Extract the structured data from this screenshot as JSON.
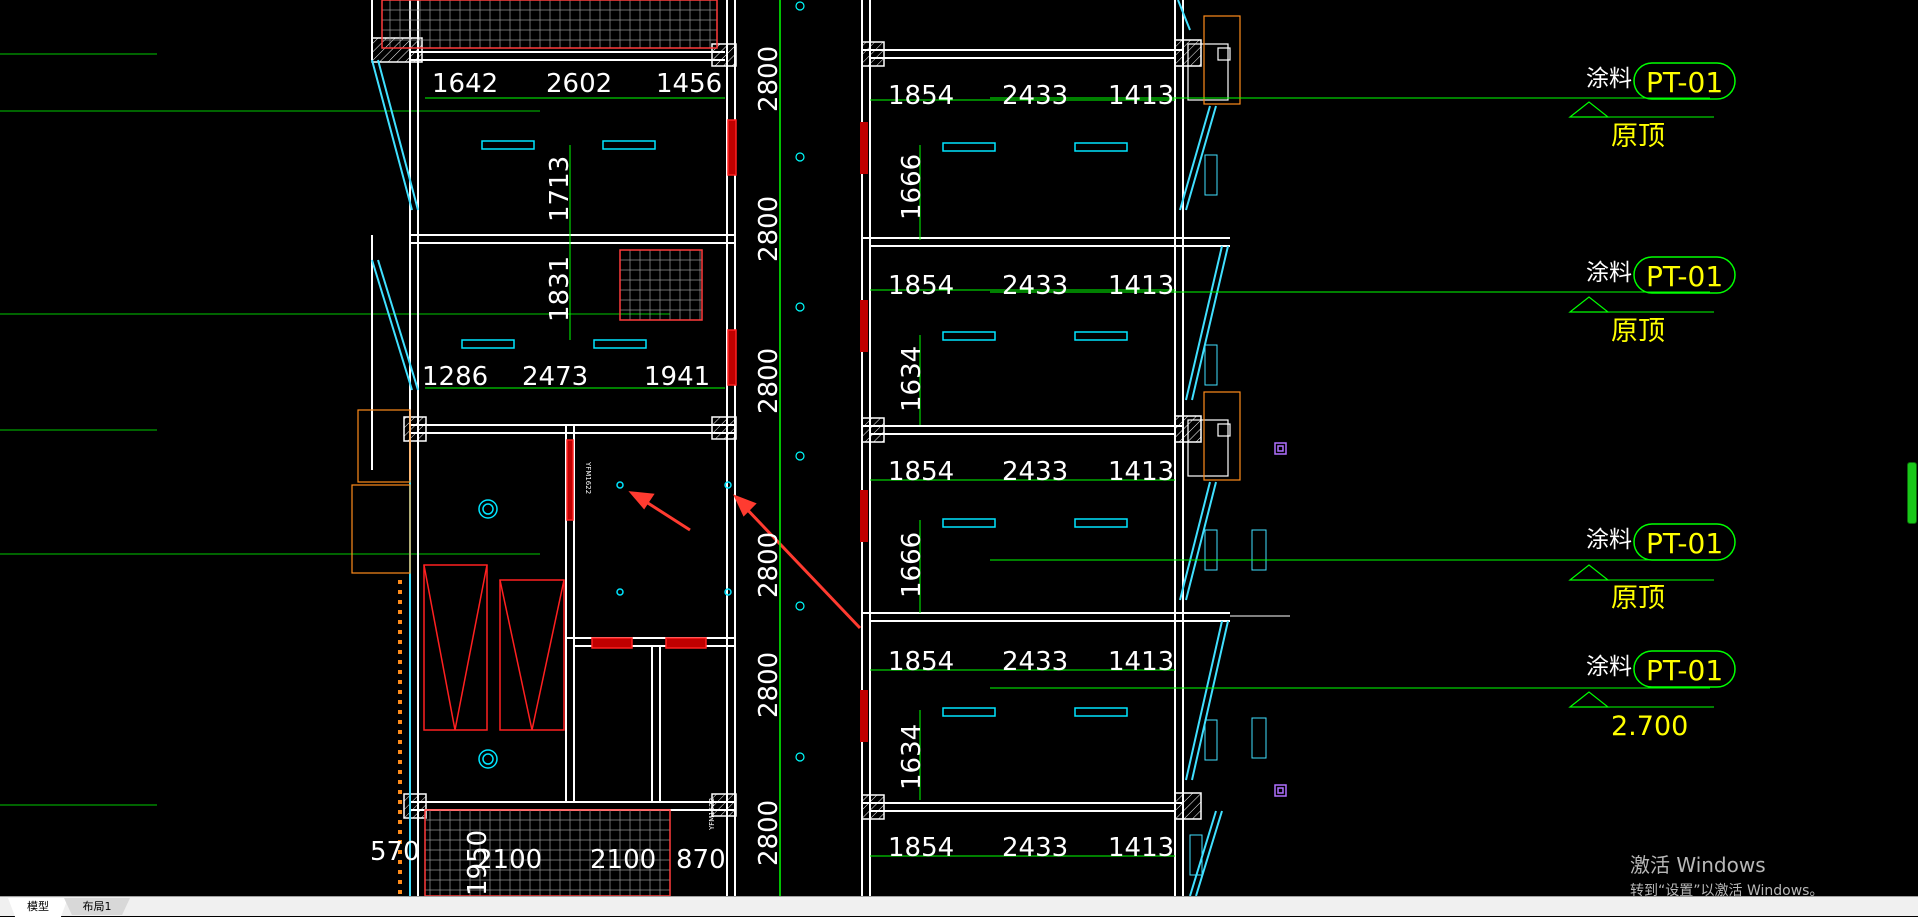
{
  "tabs": {
    "model": "模型",
    "layout1": "布局1"
  },
  "windows_watermark": {
    "title": "激活 Windows",
    "subtitle": "转到“设置”以激活 Windows。"
  },
  "colors": {
    "background": "#000000",
    "wall": "#ffffff",
    "axis": "#00ff00",
    "dimension": "#ffffff",
    "fixture": "#00ffff",
    "door": "#ff0000",
    "note_text": "#ffff00",
    "arrow": "#ff3b30"
  },
  "plan": {
    "left_top_dims": [
      "1642",
      "2602",
      "1456"
    ],
    "left_mid_dims": [
      "1286",
      "2473",
      "1941"
    ],
    "left_bottom_dims": [
      "570",
      "2100",
      "2100",
      "870"
    ],
    "left_vertical_dims": [
      "1713",
      "1831",
      "1950"
    ],
    "left_door_label": "YFM1622",
    "right_door_label": "YFM1622",
    "axis_spacing_labels": [
      "2800",
      "2800",
      "2800",
      "2800",
      "2800",
      "2800"
    ],
    "right_rows": [
      {
        "dims": [
          "1854",
          "2433",
          "1413"
        ],
        "vertical": "1666"
      },
      {
        "dims": [
          "1854",
          "2433",
          "1413"
        ],
        "vertical": "1634"
      },
      {
        "dims": [
          "1854",
          "2433",
          "1413"
        ],
        "vertical": "1666"
      },
      {
        "dims": [
          "1854",
          "2433",
          "1413"
        ],
        "vertical": "1634"
      },
      {
        "dims": [
          "1854",
          "2433",
          "1413"
        ],
        "vertical": ""
      }
    ],
    "annotations": [
      {
        "material": "涂料",
        "code": "PT-01",
        "level": "原顶"
      },
      {
        "material": "涂料",
        "code": "PT-01",
        "level": "原顶"
      },
      {
        "material": "涂料",
        "code": "PT-01",
        "level": "原顶"
      },
      {
        "material": "涂料",
        "code": "PT-01",
        "level": "2.700"
      }
    ]
  }
}
